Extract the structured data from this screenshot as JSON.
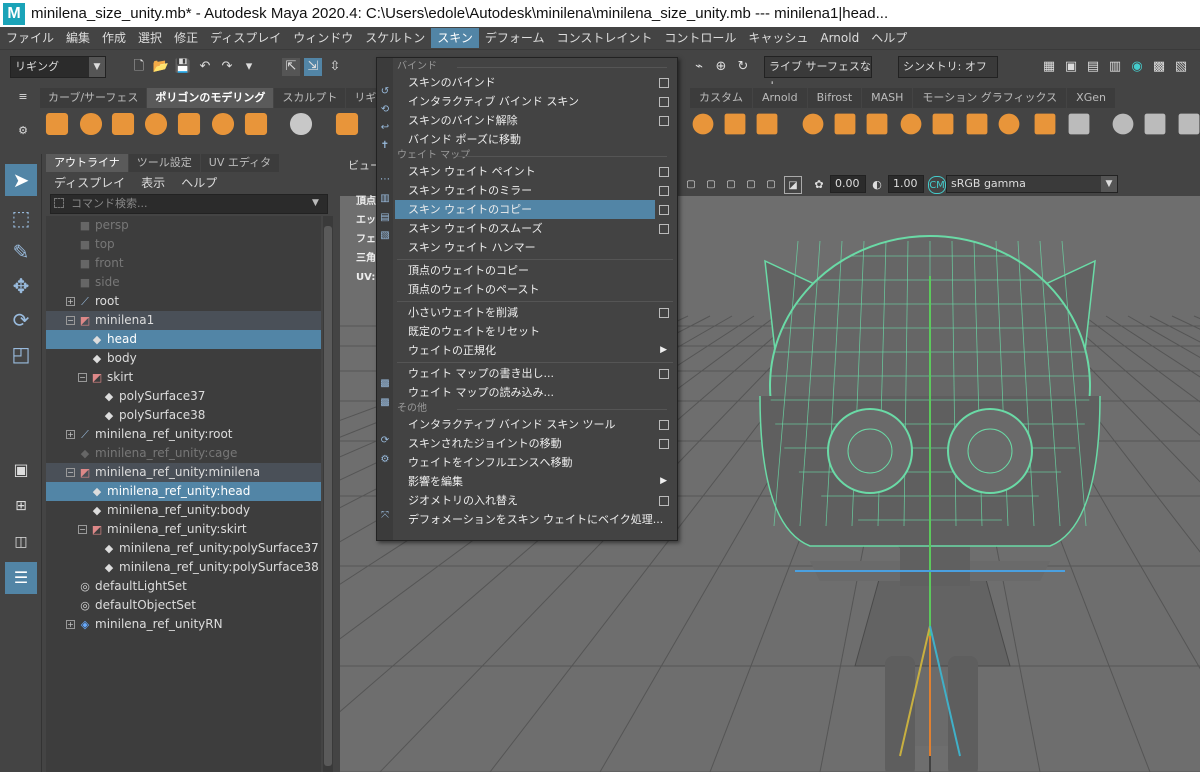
{
  "title_bar": {
    "text": "minilena_size_unity.mb* - Autodesk Maya 2020.4: C:\\Users\\edole\\Autodesk\\minilena\\minilena_size_unity.mb   ---   minilena1|head..."
  },
  "menubar": [
    "ファイル",
    "編集",
    "作成",
    "選択",
    "修正",
    "ディスプレイ",
    "ウィンドウ",
    "スケルトン",
    "スキン",
    "デフォーム",
    "コンストレイント",
    "コントロール",
    "キャッシュ",
    "Arnold",
    "ヘルプ"
  ],
  "menubar_active": "スキン",
  "status": {
    "mode": "リギング",
    "live_surface": "ライブ サーフェスなし",
    "symmetry": "シンメトリ: オフ"
  },
  "shelf_tabs": [
    "カーブ/サーフェス",
    "ポリゴンのモデリング",
    "スカルプト",
    "リギング"
  ],
  "shelf_tabs_right": [
    "カスタム",
    "Arnold",
    "Bifrost",
    "MASH",
    "モーション グラフィックス",
    "XGen"
  ],
  "outliner": {
    "tabs": [
      "アウトライナ",
      "ツール設定",
      "UV エディタ"
    ],
    "menu": [
      "ディスプレイ",
      "表示",
      "ヘルプ"
    ],
    "search_placeholder": "コマンド検索...",
    "items": [
      {
        "label": "persp",
        "icon": "camera-icon",
        "level": 1,
        "dim": true
      },
      {
        "label": "top",
        "icon": "camera-icon",
        "level": 1,
        "dim": true
      },
      {
        "label": "front",
        "icon": "camera-icon",
        "level": 1,
        "dim": true
      },
      {
        "label": "side",
        "icon": "camera-icon",
        "level": 1,
        "dim": true
      },
      {
        "label": "root",
        "icon": "joint-icon",
        "level": 1,
        "expand": "+"
      },
      {
        "label": "minilena1",
        "icon": "group-icon",
        "level": 1,
        "expand": "−",
        "state": "hl"
      },
      {
        "label": "head",
        "icon": "mesh-icon",
        "level": 2,
        "state": "sel"
      },
      {
        "label": "body",
        "icon": "mesh-icon",
        "level": 2
      },
      {
        "label": "skirt",
        "icon": "group-icon",
        "level": 2,
        "expand": "−"
      },
      {
        "label": "polySurface37",
        "icon": "mesh-icon",
        "level": 3
      },
      {
        "label": "polySurface38",
        "icon": "mesh-icon",
        "level": 3
      },
      {
        "label": "minilena_ref_unity:root",
        "icon": "joint-icon",
        "level": 1,
        "expand": "+"
      },
      {
        "label": "minilena_ref_unity:cage",
        "icon": "mesh-icon",
        "level": 1,
        "dim": true
      },
      {
        "label": "minilena_ref_unity:minilena",
        "icon": "group-icon",
        "level": 1,
        "expand": "−",
        "state": "hl"
      },
      {
        "label": "minilena_ref_unity:head",
        "icon": "mesh-icon",
        "level": 2,
        "state": "sel"
      },
      {
        "label": "minilena_ref_unity:body",
        "icon": "mesh-icon",
        "level": 2
      },
      {
        "label": "minilena_ref_unity:skirt",
        "icon": "group-icon",
        "level": 2,
        "expand": "−"
      },
      {
        "label": "minilena_ref_unity:polySurface37",
        "icon": "mesh-icon",
        "level": 3
      },
      {
        "label": "minilena_ref_unity:polySurface38",
        "icon": "mesh-icon",
        "level": 3
      },
      {
        "label": "defaultLightSet",
        "icon": "set-icon",
        "level": 1
      },
      {
        "label": "defaultObjectSet",
        "icon": "set-icon",
        "level": 1
      },
      {
        "label": "minilena_ref_unityRN",
        "icon": "reference-icon",
        "level": 1,
        "expand": "+"
      }
    ]
  },
  "viewport": {
    "panel_menu": "ビュー",
    "value1": "0.00",
    "value2": "1.00",
    "colorspace": "sRGB gamma",
    "hud": [
      "頂点",
      "エッジ",
      "フェース",
      "三角",
      "UV:"
    ]
  },
  "skin_menu": {
    "sections": [
      {
        "title": "バインド",
        "items": [
          {
            "label": "スキンのバインド",
            "option": true
          },
          {
            "label": "インタラクティブ バインド スキン",
            "option": true
          },
          {
            "label": "スキンのバインド解除",
            "option": true
          },
          {
            "label": "バインド ポーズに移動",
            "option": false
          }
        ]
      },
      {
        "title": "ウェイト マップ",
        "items": [
          {
            "label": "スキン ウェイト ペイント",
            "option": true
          },
          {
            "label": "スキン ウェイトのミラー",
            "option": true
          },
          {
            "label": "スキン ウェイトのコピー",
            "option": true,
            "selected": true
          },
          {
            "label": "スキン ウェイトのスムーズ",
            "option": true
          },
          {
            "label": "スキン ウェイト ハンマー",
            "option": false
          },
          {
            "label": "頂点のウェイトのコピー",
            "option": false,
            "sep_before": true
          },
          {
            "label": "頂点のウェイトのペースト",
            "option": false
          },
          {
            "label": "小さいウェイトを削減",
            "option": true,
            "sep_before": true
          },
          {
            "label": "既定のウェイトをリセット",
            "option": false
          },
          {
            "label": "ウェイトの正規化",
            "option": false,
            "submenu": true
          },
          {
            "label": "ウェイト マップの書き出し...",
            "option": true,
            "sep_before": true
          },
          {
            "label": "ウェイト マップの読み込み...",
            "option": false
          }
        ]
      },
      {
        "title": "その他",
        "items": [
          {
            "label": "インタラクティブ バインド スキン ツール",
            "option": true
          },
          {
            "label": "スキンされたジョイントの移動",
            "option": true
          },
          {
            "label": "ウェイトをインフルエンスへ移動",
            "option": false
          },
          {
            "label": "影響を編集",
            "option": false,
            "submenu": true
          },
          {
            "label": "ジオメトリの入れ替え",
            "option": true
          },
          {
            "label": "デフォメーションをスキン ウェイトにベイク処理...",
            "option": false
          }
        ]
      }
    ]
  }
}
